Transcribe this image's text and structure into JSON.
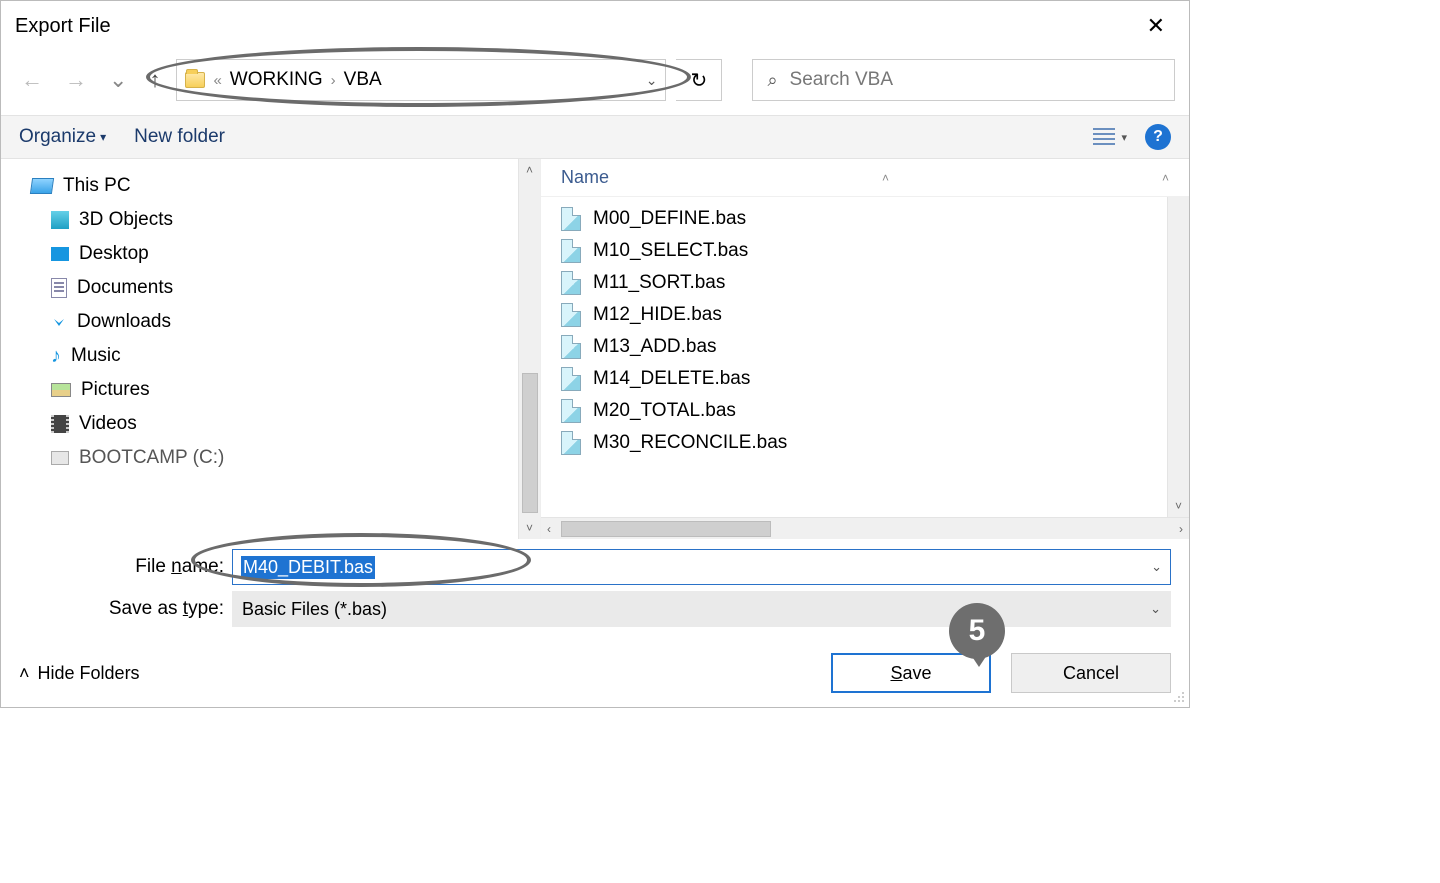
{
  "title": "Export File",
  "breadcrumb": {
    "prefix": "«",
    "parent": "WORKING",
    "current": "VBA"
  },
  "search": {
    "placeholder": "Search VBA"
  },
  "toolbar": {
    "organize": "Organize",
    "new_folder": "New folder"
  },
  "tree": {
    "root": "This PC",
    "items": [
      "3D Objects",
      "Desktop",
      "Documents",
      "Downloads",
      "Music",
      "Pictures",
      "Videos",
      "BOOTCAMP (C:)"
    ]
  },
  "files": {
    "header": "Name",
    "list": [
      "M00_DEFINE.bas",
      "M10_SELECT.bas",
      "M11_SORT.bas",
      "M12_HIDE.bas",
      "M13_ADD.bas",
      "M14_DELETE.bas",
      "M20_TOTAL.bas",
      "M30_RECONCILE.bas"
    ]
  },
  "form": {
    "filename_label_pre": "File ",
    "filename_label_u": "n",
    "filename_label_post": "ame:",
    "filename_value": "M40_DEBIT.bas",
    "type_label_pre": "Save as ",
    "type_label_u": "t",
    "type_label_post": "ype:",
    "type_value": "Basic Files (*.bas)"
  },
  "buttons": {
    "hide_folders": "Hide Folders",
    "save_pre": "",
    "save_u": "S",
    "save_post": "ave",
    "cancel": "Cancel"
  },
  "annotation": {
    "step": "5"
  }
}
